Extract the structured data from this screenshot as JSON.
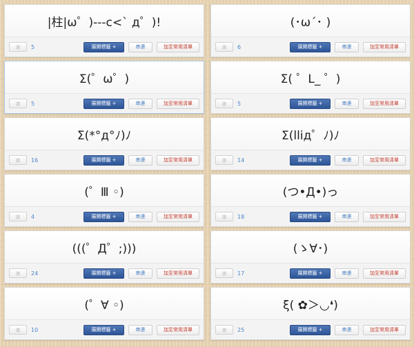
{
  "buttons": {
    "like": "讚",
    "tags": "展開標籤 +",
    "report": "串連",
    "favorite": "加至常用清單"
  },
  "colors": {
    "count": "#4a86c8",
    "tags_button": "#3a62a5",
    "favorite_text": "#c0392b"
  },
  "cards": [
    {
      "kaomoji": "|柱|ω゜)---c<` д゜)!",
      "count": "5"
    },
    {
      "kaomoji": "(･ω´･ )",
      "count": "6"
    },
    {
      "kaomoji": "Σ(゜ω゜)",
      "count": "5"
    },
    {
      "kaomoji": "Σ( ゜L_ ゜)",
      "count": "5"
    },
    {
      "kaomoji": "Σ(*°д°ﾉ)ﾉ",
      "count": "16"
    },
    {
      "kaomoji": "Σ(lliд゜ﾉ)ﾉ",
      "count": "14"
    },
    {
      "kaomoji": "(゜Ⅲ ◦)",
      "count": "4"
    },
    {
      "kaomoji": "(つ•Д•)っ",
      "count": "18"
    },
    {
      "kaomoji": "(((゜Д゜;)))",
      "count": "24"
    },
    {
      "kaomoji": "(ゝ∀･)",
      "count": "17"
    },
    {
      "kaomoji": "(゜∀ ◦)",
      "count": "10"
    },
    {
      "kaomoji": "ξ( ✿＞◡❛)",
      "count": "25"
    }
  ]
}
